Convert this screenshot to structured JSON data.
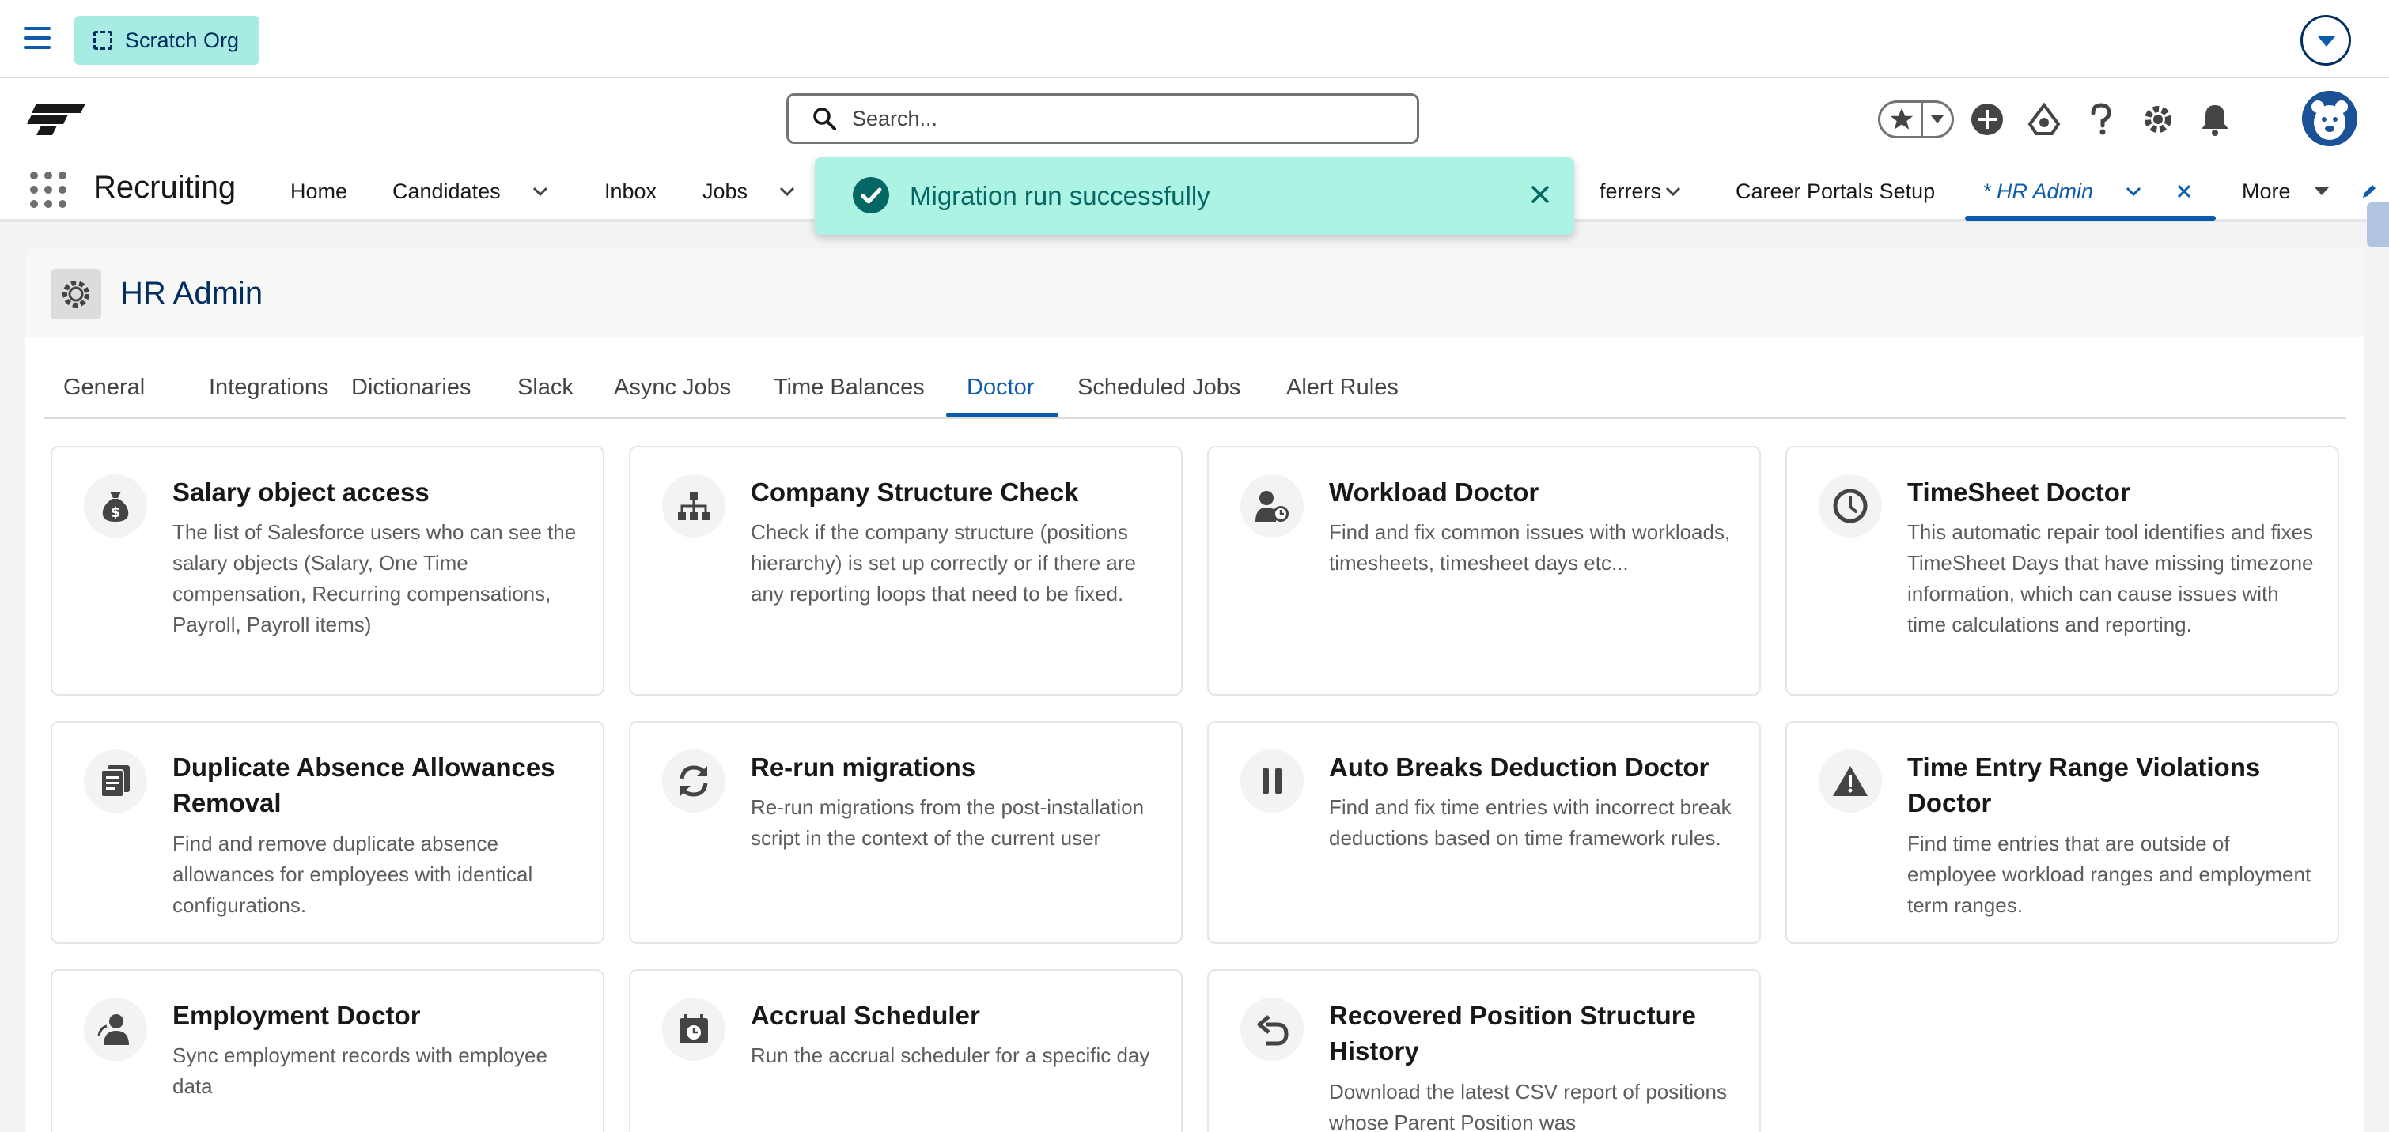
{
  "org": {
    "name": "Scratch Org"
  },
  "search": {
    "placeholder": "Search..."
  },
  "app": {
    "name": "Recruiting",
    "nav": {
      "home": "Home",
      "candidates": "Candidates",
      "inbox": "Inbox",
      "jobs": "Jobs",
      "referrers": "ferrers",
      "career_portals": "Career Portals Setup",
      "hr_admin": "* HR Admin",
      "more": "More"
    }
  },
  "toast": {
    "message": "Migration run successfully"
  },
  "page": {
    "title": "HR Admin",
    "tabs": [
      "General",
      "Integrations",
      "Dictionaries",
      "Slack",
      "Async Jobs",
      "Time Balances",
      "Doctor",
      "Scheduled Jobs",
      "Alert Rules"
    ],
    "active_tab": "Doctor"
  },
  "tiles": [
    {
      "title": "Salary object access",
      "icon": "money-bag-icon",
      "description": "The list of Salesforce users who can see the salary objects (Salary, One Time compensation, Recurring compensations, Payroll, Payroll items)"
    },
    {
      "title": "Company Structure Check",
      "icon": "hierarchy-icon",
      "description": "Check if the company structure (positions hierarchy) is set up correctly or if there are any reporting loops that need to be fixed."
    },
    {
      "title": "Workload Doctor",
      "icon": "user-clock-icon",
      "description": "Find and fix common issues with workloads, timesheets, timesheet days etc..."
    },
    {
      "title": "TimeSheet Doctor",
      "icon": "clock-icon",
      "description": "This automatic repair tool identifies and fixes TimeSheet Days that have missing timezone information, which can cause issues with time calculations and reporting."
    },
    {
      "title": "Duplicate Absence Allowances Removal",
      "icon": "document-icon",
      "description": "Find and remove duplicate absence allowances for employees with identical configurations."
    },
    {
      "title": "Re-run migrations",
      "icon": "refresh-icon",
      "description": "Re-run migrations from the post-installation script in the context of the current user"
    },
    {
      "title": "Auto Breaks Deduction Doctor",
      "icon": "pause-icon",
      "description": "Find and fix time entries with incorrect break deductions based on time framework rules."
    },
    {
      "title": "Time Entry Range Violations Doctor",
      "icon": "warning-icon",
      "description": "Find time entries that are outside of employee workload ranges and employment term ranges."
    },
    {
      "title": "Employment Doctor",
      "icon": "user-sync-icon",
      "description": "Sync employment records with employee data"
    },
    {
      "title": "Accrual Scheduler",
      "icon": "calendar-clock-icon",
      "description": "Run the accrual scheduler for a specific day"
    },
    {
      "title": "Recovered Position Structure History",
      "icon": "undo-icon",
      "description": "Download the latest CSV report of positions whose Parent Position was"
    }
  ],
  "colors": {
    "brand": "#0b5cab",
    "toast_bg": "#acf3e4",
    "toast_text": "#056764",
    "org_pill": "#a8ebe3"
  }
}
